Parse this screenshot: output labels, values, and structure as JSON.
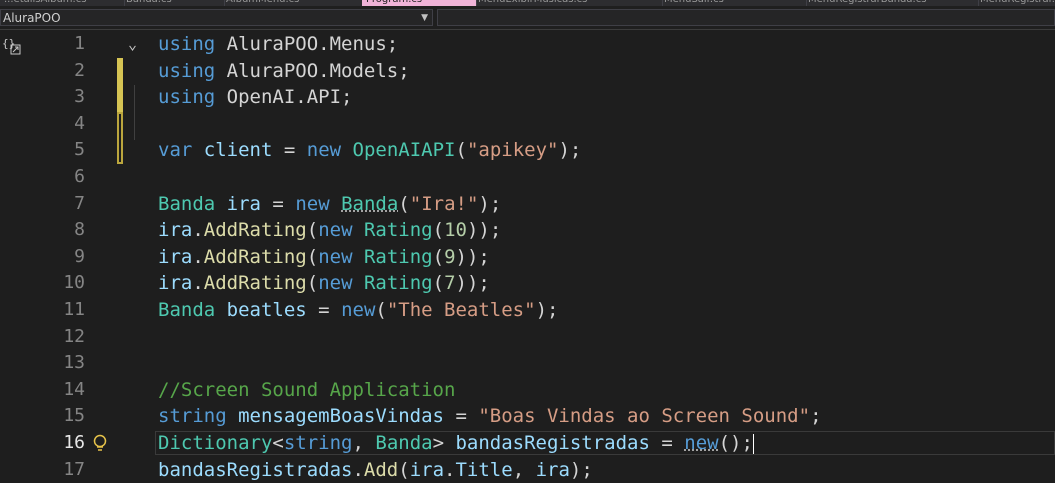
{
  "tabs": [
    {
      "label": "...etailsAlbum.cs",
      "active": false
    },
    {
      "label": "Banda.cs",
      "active": false
    },
    {
      "label": "AlbumMenu.cs",
      "active": false
    },
    {
      "label": "Program.cs",
      "active": true
    },
    {
      "label": "MenuExibirMusicas.cs",
      "active": false
    },
    {
      "label": "MenuSair.cs",
      "active": false
    },
    {
      "label": "MenuRegistrarBanda.cs",
      "active": false
    },
    {
      "label": "MenuRegistrar...",
      "active": false
    }
  ],
  "navbar": {
    "project": "AluraPOO",
    "scope": ""
  },
  "editor": {
    "lines": [
      {
        "n": "1",
        "tokens": [
          [
            "kw",
            "using"
          ],
          [
            "pl",
            " AluraPOO.Menus;"
          ]
        ]
      },
      {
        "n": "2",
        "tokens": [
          [
            "kw",
            "using"
          ],
          [
            "pl",
            " AluraPOO.Models;"
          ]
        ]
      },
      {
        "n": "3",
        "tokens": [
          [
            "kw",
            "using"
          ],
          [
            "pl",
            " OpenAI.API;"
          ]
        ]
      },
      {
        "n": "4",
        "tokens": []
      },
      {
        "n": "5",
        "tokens": [
          [
            "kw",
            "var"
          ],
          [
            "pl",
            " "
          ],
          [
            "id",
            "client"
          ],
          [
            "pl",
            " = "
          ],
          [
            "kw",
            "new"
          ],
          [
            "pl",
            " "
          ],
          [
            "ty",
            "OpenAIAPI"
          ],
          [
            "pl",
            "("
          ],
          [
            "st",
            "\"apikey\""
          ],
          [
            "pl",
            ");"
          ]
        ]
      },
      {
        "n": "6",
        "tokens": []
      },
      {
        "n": "7",
        "tokens": [
          [
            "ty",
            "Banda"
          ],
          [
            "pl",
            " "
          ],
          [
            "id",
            "ira"
          ],
          [
            "pl",
            " = "
          ],
          [
            "kw",
            "new"
          ],
          [
            "pl",
            " "
          ],
          [
            "ty",
            "Banda"
          ],
          [
            "pl",
            "("
          ],
          [
            "st",
            "\"Ira!\""
          ],
          [
            "pl",
            ");"
          ]
        ]
      },
      {
        "n": "8",
        "tokens": [
          [
            "id",
            "ira"
          ],
          [
            "pl",
            "."
          ],
          [
            "me",
            "AddRating"
          ],
          [
            "pl",
            "("
          ],
          [
            "kw",
            "new"
          ],
          [
            "pl",
            " "
          ],
          [
            "ty",
            "Rating"
          ],
          [
            "pl",
            "("
          ],
          [
            "nu",
            "10"
          ],
          [
            "pl",
            "));"
          ]
        ]
      },
      {
        "n": "9",
        "tokens": [
          [
            "id",
            "ira"
          ],
          [
            "pl",
            "."
          ],
          [
            "me",
            "AddRating"
          ],
          [
            "pl",
            "("
          ],
          [
            "kw",
            "new"
          ],
          [
            "pl",
            " "
          ],
          [
            "ty",
            "Rating"
          ],
          [
            "pl",
            "("
          ],
          [
            "nu",
            "9"
          ],
          [
            "pl",
            "));"
          ]
        ]
      },
      {
        "n": "10",
        "tokens": [
          [
            "id",
            "ira"
          ],
          [
            "pl",
            "."
          ],
          [
            "me",
            "AddRating"
          ],
          [
            "pl",
            "("
          ],
          [
            "kw",
            "new"
          ],
          [
            "pl",
            " "
          ],
          [
            "ty",
            "Rating"
          ],
          [
            "pl",
            "("
          ],
          [
            "nu",
            "7"
          ],
          [
            "pl",
            "));"
          ]
        ]
      },
      {
        "n": "11",
        "tokens": [
          [
            "ty",
            "Banda"
          ],
          [
            "pl",
            " "
          ],
          [
            "id",
            "beatles"
          ],
          [
            "pl",
            " = "
          ],
          [
            "kw",
            "new"
          ],
          [
            "pl",
            "("
          ],
          [
            "st",
            "\"The Beatles\""
          ],
          [
            "pl",
            ");"
          ]
        ]
      },
      {
        "n": "12",
        "tokens": []
      },
      {
        "n": "13",
        "tokens": []
      },
      {
        "n": "14",
        "tokens": [
          [
            "cm",
            "//Screen Sound Application"
          ]
        ]
      },
      {
        "n": "15",
        "tokens": [
          [
            "kw",
            "string"
          ],
          [
            "pl",
            " "
          ],
          [
            "id",
            "mensagemBoasVindas"
          ],
          [
            "pl",
            " = "
          ],
          [
            "st",
            "\"Boas Vindas ao Screen Sound\""
          ],
          [
            "pl",
            ";"
          ]
        ]
      },
      {
        "n": "16",
        "tokens": [
          [
            "ty",
            "Dictionary"
          ],
          [
            "pl",
            "<"
          ],
          [
            "kw",
            "string"
          ],
          [
            "pl",
            ", "
          ],
          [
            "ty",
            "Banda"
          ],
          [
            "pl",
            "> "
          ],
          [
            "id",
            "bandasRegistradas"
          ],
          [
            "pl",
            " = "
          ],
          [
            "kw",
            "new"
          ],
          [
            "pl",
            "();"
          ]
        ]
      },
      {
        "n": "17",
        "tokens": [
          [
            "id",
            "bandasRegistradas"
          ],
          [
            "pl",
            "."
          ],
          [
            "me",
            "Add"
          ],
          [
            "pl",
            "("
          ],
          [
            "id",
            "ira"
          ],
          [
            "pl",
            "."
          ],
          [
            "id",
            "Title"
          ],
          [
            "pl",
            ", "
          ],
          [
            "id",
            "ira"
          ],
          [
            "pl",
            ");"
          ]
        ]
      }
    ],
    "current_line": "16",
    "colors": {
      "keyword": "#569cd6",
      "type": "#4ec9b0",
      "identifier": "#9cdcfe",
      "method": "#dcdcaa",
      "string": "#d69d85",
      "number": "#b5cea8",
      "comment": "#57a64a",
      "change_bar": "#d6c454"
    },
    "icons": [
      "scope-braces-icon",
      "fold-chevron-icon",
      "lightbulb-icon"
    ]
  }
}
